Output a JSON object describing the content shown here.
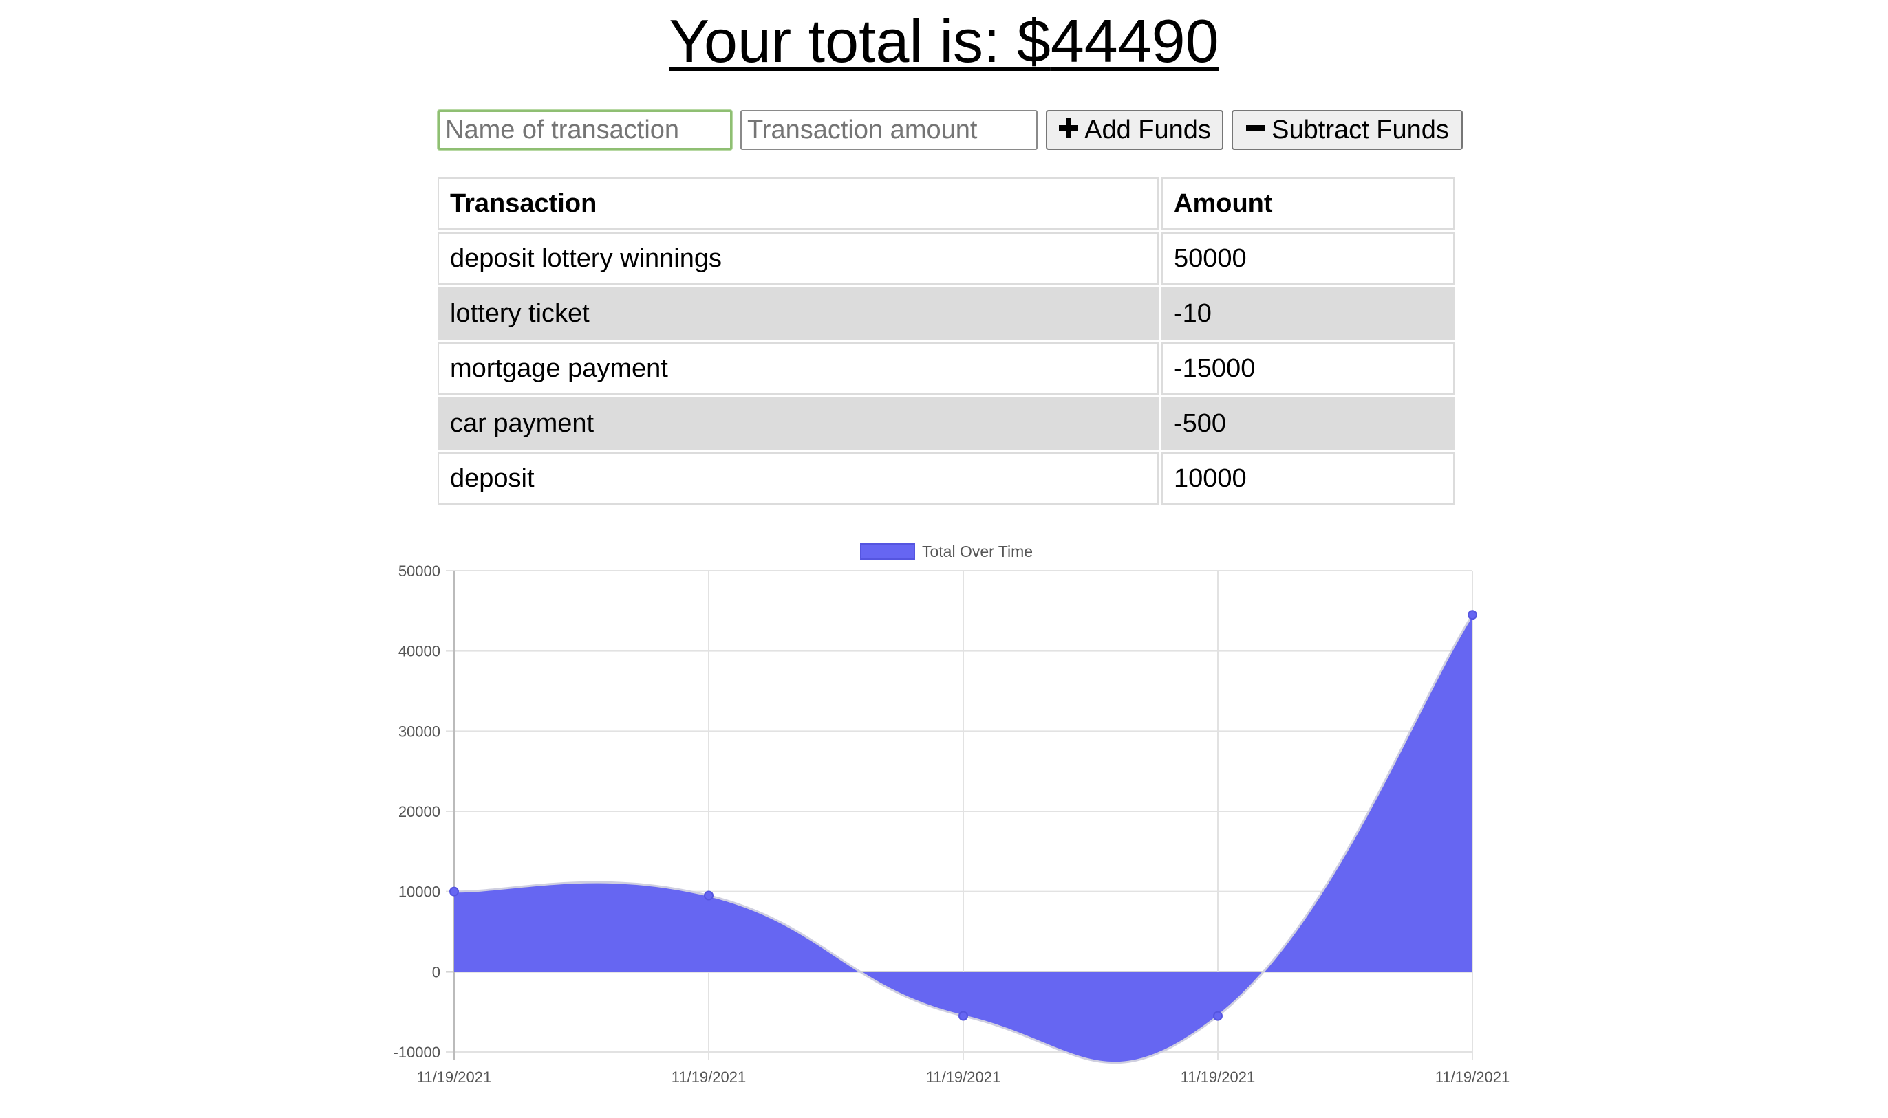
{
  "header": {
    "total_label": "Your total is: $",
    "total_value": "44490"
  },
  "form": {
    "name_placeholder": "Name of transaction",
    "amount_placeholder": "Transaction amount",
    "add_label": "Add Funds",
    "add_icon": "plus-icon",
    "subtract_label": "Subtract Funds",
    "subtract_icon": "minus-icon"
  },
  "table": {
    "headers": [
      "Transaction",
      "Amount"
    ],
    "rows": [
      {
        "name": "deposit lottery winnings",
        "amount": "50000"
      },
      {
        "name": "lottery ticket",
        "amount": "-10"
      },
      {
        "name": "mortgage payment",
        "amount": "-15000"
      },
      {
        "name": "car payment",
        "amount": "-500"
      },
      {
        "name": "deposit",
        "amount": "10000"
      }
    ]
  },
  "colors": {
    "fill": "#6666f2",
    "line": "#cfcfe0",
    "row_shade": "#dcdcdc",
    "focus": "#8fbf73"
  },
  "chart_data": {
    "type": "area",
    "x": [
      "11/19/2021",
      "11/19/2021",
      "11/19/2021",
      "11/19/2021",
      "11/19/2021"
    ],
    "series": [
      {
        "name": "Total Over Time",
        "values": [
          10000,
          9500,
          -5500,
          -5510,
          44490
        ]
      }
    ],
    "ylim": [
      -10000,
      50000
    ],
    "yticks": [
      "50000",
      "40000",
      "30000",
      "20000",
      "10000",
      "0",
      "-10000"
    ],
    "grid": true,
    "legend_position": "top-center",
    "curve": "smooth"
  }
}
